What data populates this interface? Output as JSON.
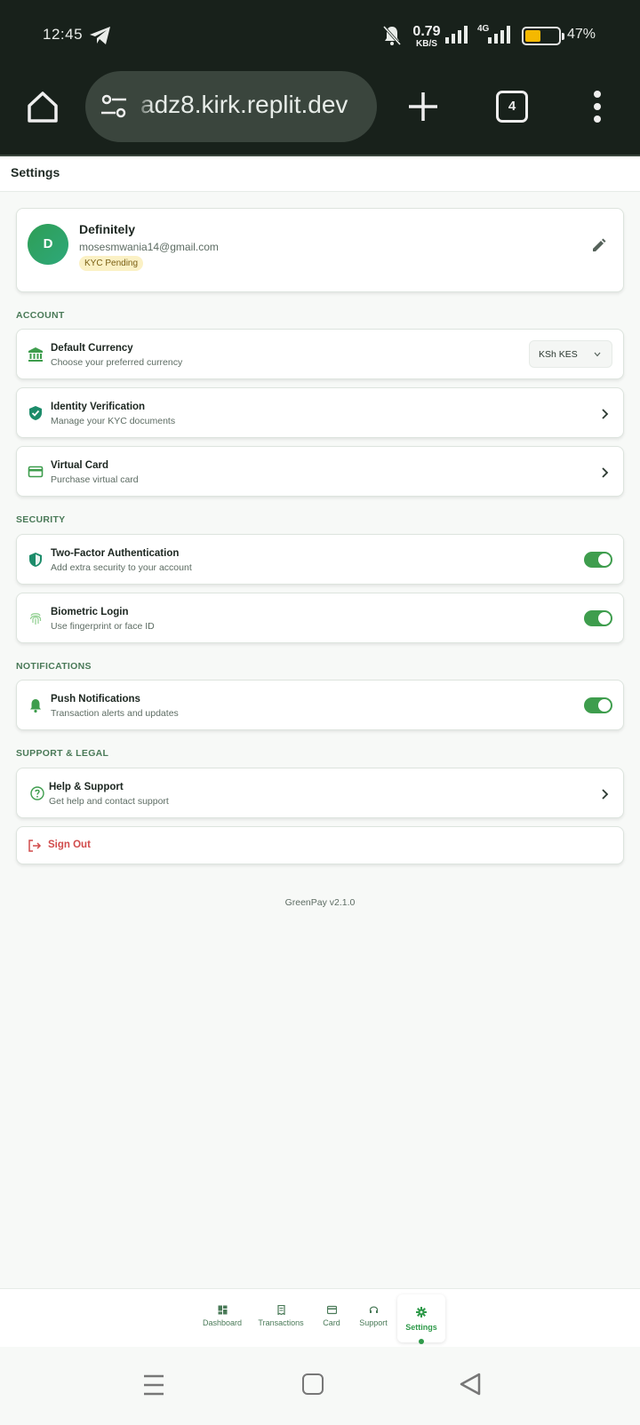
{
  "status_bar": {
    "time": "12:45",
    "net_speed_value": "0.79",
    "net_speed_unit": "KB/S",
    "network_type": "4G",
    "battery_percent": "47%",
    "battery_level": 0.47,
    "icons": [
      "telegram-icon",
      "mute-icon",
      "signal-icon",
      "battery-icon"
    ]
  },
  "browser": {
    "url": "adz8.kirk.replit.dev",
    "tab_count": "4",
    "icons": [
      "home-icon",
      "site-settings-icon",
      "new-tab-icon",
      "tabs-icon",
      "more-icon"
    ]
  },
  "header": {
    "title": "Settings"
  },
  "profile": {
    "avatar_initial": "D",
    "name": "Definitely",
    "email": "mosesmwania14@gmail.com",
    "kyc_badge": "KYC Pending"
  },
  "sections": {
    "account": "ACCOUNT",
    "security": "SECURITY",
    "notifications": "NOTIFICATIONS",
    "support": "SUPPORT & LEGAL"
  },
  "account": {
    "currency": {
      "title": "Default Currency",
      "subtitle": "Choose your preferred currency",
      "value": "KSh KES"
    },
    "identity": {
      "title": "Identity Verification",
      "subtitle": "Manage your KYC documents"
    },
    "virtual_card": {
      "title": "Virtual Card",
      "subtitle": "Purchase virtual card"
    }
  },
  "security": {
    "two_factor": {
      "title": "Two-Factor Authentication",
      "subtitle": "Add extra security to your account",
      "enabled": true
    },
    "biometric": {
      "title": "Biometric Login",
      "subtitle": "Use fingerprint or face ID",
      "enabled": true
    }
  },
  "notifications": {
    "push": {
      "title": "Push Notifications",
      "subtitle": "Transaction alerts and updates",
      "enabled": true
    }
  },
  "support": {
    "help": {
      "title": "Help & Support",
      "subtitle": "Get help and contact support"
    },
    "sign_out": "Sign Out"
  },
  "version": "GreenPay v2.1.0",
  "bottom_nav": {
    "dashboard": "Dashboard",
    "transactions": "Transactions",
    "card": "Card",
    "support": "Support",
    "settings": "Settings",
    "active": "settings"
  },
  "colors": {
    "brand_green": "#2f9a4a",
    "toggle_on": "#3e9d4d",
    "danger": "#d14b4b",
    "kyc_badge_bg": "#fbf1c5",
    "battery_fill": "#f5b800"
  }
}
